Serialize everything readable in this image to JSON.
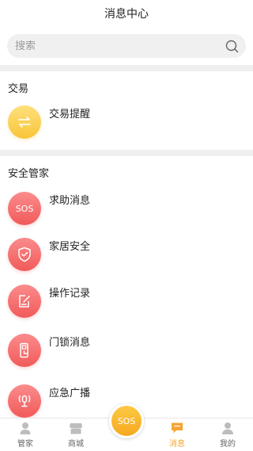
{
  "header": {
    "title": "消息中心"
  },
  "search": {
    "placeholder": "搜索",
    "icon": "search-icon"
  },
  "sections": {
    "trade": {
      "title": "交易",
      "items": [
        {
          "label": "交易提醒",
          "icon": "swap-arrows-icon",
          "color": "#f9c53a"
        }
      ]
    },
    "security": {
      "title": "安全管家",
      "items": [
        {
          "label": "求助消息",
          "icon": "sos-icon",
          "icon_text": "SOS",
          "color": "#f15a5a"
        },
        {
          "label": "家居安全",
          "icon": "shield-check-icon",
          "color": "#f15a5a"
        },
        {
          "label": "操作记录",
          "icon": "edit-record-icon",
          "color": "#f15a5a"
        },
        {
          "label": "门锁消息",
          "icon": "door-lock-icon",
          "color": "#f15a5a"
        },
        {
          "label": "应急广播",
          "icon": "broadcast-icon",
          "color": "#f15a5a"
        }
      ]
    }
  },
  "tabbar": {
    "items": [
      {
        "label": "管家",
        "icon": "butler-icon",
        "active": false
      },
      {
        "label": "商城",
        "icon": "store-icon",
        "active": false
      },
      {
        "label": "",
        "icon": "",
        "active": false
      },
      {
        "label": "消息",
        "icon": "message-icon",
        "active": true
      },
      {
        "label": "我的",
        "icon": "profile-icon",
        "active": false
      }
    ],
    "sos_label": "SOS",
    "active_color": "#f4a533"
  }
}
